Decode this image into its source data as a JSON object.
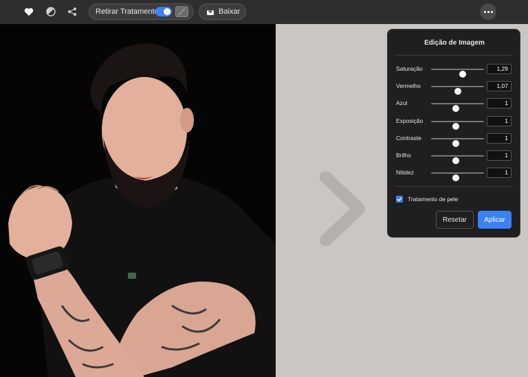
{
  "toolbar": {
    "icons": [
      "heart-icon",
      "contrast-icon",
      "share-icon"
    ],
    "toggle_label": "Retirar Tratamento",
    "toggle_on": true,
    "download_label": "Baixar",
    "accent": "#3b82f6"
  },
  "panel": {
    "title": "Edição de Imagem",
    "sliders": [
      {
        "label": "Saturação",
        "value": "1,29",
        "fraction": 0.6
      },
      {
        "label": "Vermelho",
        "value": "1,07",
        "fraction": 0.51
      },
      {
        "label": "Azul",
        "value": "1",
        "fraction": 0.47
      },
      {
        "label": "Exposição",
        "value": "1",
        "fraction": 0.47
      },
      {
        "label": "Contraste",
        "value": "1",
        "fraction": 0.47
      },
      {
        "label": "Brilho",
        "value": "1",
        "fraction": 0.47
      },
      {
        "label": "Nitidez",
        "value": "1",
        "fraction": 0.47
      }
    ],
    "skin_label": "Tratamento de pele",
    "skin_checked": true,
    "reset_label": "Resetar",
    "apply_label": "Aplicar"
  }
}
